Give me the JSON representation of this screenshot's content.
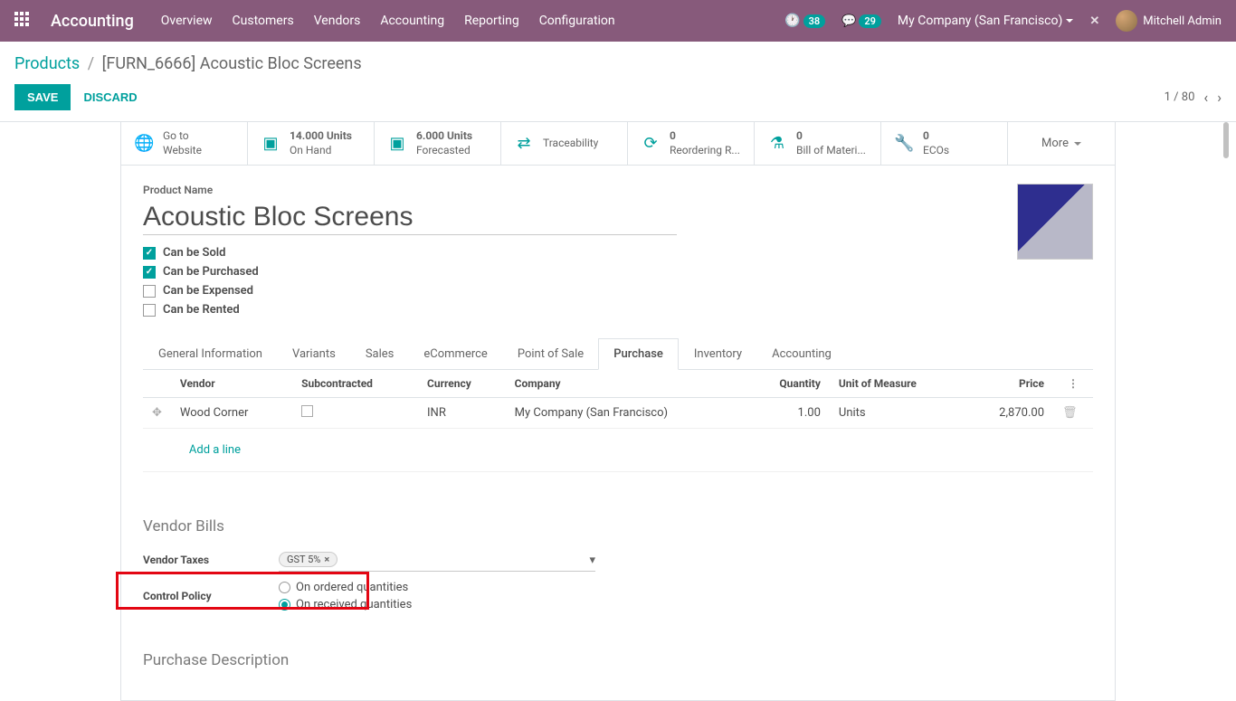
{
  "nav": {
    "brand": "Accounting",
    "menu": [
      "Overview",
      "Customers",
      "Vendors",
      "Accounting",
      "Reporting",
      "Configuration"
    ],
    "activity_count": "38",
    "message_count": "29",
    "company": "My Company (San Francisco)",
    "user": "Mitchell Admin"
  },
  "breadcrumb": {
    "root": "Products",
    "current": "[FURN_6666] Acoustic Bloc Screens"
  },
  "actions": {
    "save": "SAVE",
    "discard": "DISCARD",
    "pager": "1 / 80"
  },
  "stats": {
    "goto_a": "Go to",
    "goto_b": "Website",
    "onhand_a": "14.000 Units",
    "onhand_b": "On Hand",
    "forecast_a": "6.000 Units",
    "forecast_b": "Forecasted",
    "trace": "Traceability",
    "reorder_a": "0",
    "reorder_b": "Reordering R...",
    "bom_a": "0",
    "bom_b": "Bill of Materi...",
    "eco_a": "0",
    "eco_b": "ECOs",
    "more": "More"
  },
  "form": {
    "name_label": "Product Name",
    "name": "Acoustic Bloc Screens",
    "cb_sold": "Can be Sold",
    "cb_purchased": "Can be Purchased",
    "cb_expensed": "Can be Expensed",
    "cb_rented": "Can be Rented"
  },
  "tabs": [
    "General Information",
    "Variants",
    "Sales",
    "eCommerce",
    "Point of Sale",
    "Purchase",
    "Inventory",
    "Accounting"
  ],
  "vendor_table": {
    "h_vendor": "Vendor",
    "h_sub": "Subcontracted",
    "h_curr": "Currency",
    "h_company": "Company",
    "h_qty": "Quantity",
    "h_uom": "Unit of Measure",
    "h_price": "Price",
    "r0": {
      "vendor": "Wood Corner",
      "currency": "INR",
      "company": "My Company (San Francisco)",
      "qty": "1.00",
      "uom": "Units",
      "price": "2,870.00"
    },
    "add": "Add a line"
  },
  "vendor_bills": {
    "title": "Vendor Bills",
    "taxes_label": "Vendor Taxes",
    "taxes_tag": "GST 5%",
    "policy_label": "Control Policy",
    "policy_ordered": "On ordered quantities",
    "policy_received": "On received quantities"
  },
  "purchase_desc": {
    "title": "Purchase Description"
  }
}
